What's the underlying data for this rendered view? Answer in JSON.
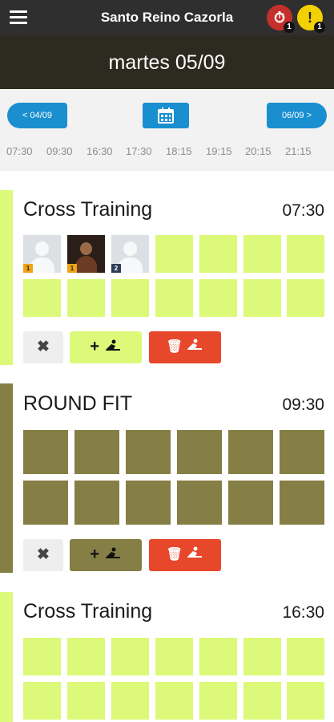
{
  "header": {
    "title": "Santo Reino Cazorla",
    "menu_icon": "hamburger-menu-icon",
    "notifications": [
      {
        "icon": "stopwatch-icon",
        "count": "1",
        "color": "#c4302b"
      },
      {
        "icon": "alert-icon",
        "count": "1",
        "color": "#f3d000"
      }
    ]
  },
  "date_title": "martes 05/09",
  "navigation": {
    "prev_label": "< 04/09",
    "calendar_icon": "calendar-icon",
    "next_label": "06/09 >",
    "times": [
      "07:30",
      "09:30",
      "16:30",
      "17:30",
      "18:15",
      "19:15",
      "20:15",
      "21:15"
    ]
  },
  "classes": [
    {
      "name": "Cross Training",
      "time": "07:30",
      "color": "#dcf97a",
      "attendees": [
        {
          "type": "placeholder-avatar",
          "badge": "1",
          "badge_color": "#f0a415"
        },
        {
          "type": "photo-avatar",
          "badge": "1",
          "badge_color": "#f0a415"
        },
        {
          "type": "placeholder-avatar",
          "badge": "2",
          "badge_color": "#2f3e58"
        }
      ],
      "actions": {
        "cancel": "✖",
        "add": "+",
        "delete": "🗑"
      }
    },
    {
      "name": "ROUND FIT",
      "time": "09:30",
      "color": "#857f45",
      "attendees": [],
      "actions": {
        "cancel": "✖",
        "add": "+",
        "delete": "🗑"
      }
    },
    {
      "name": "Cross Training",
      "time": "16:30",
      "color": "#dcf97a",
      "attendees": []
    }
  ]
}
